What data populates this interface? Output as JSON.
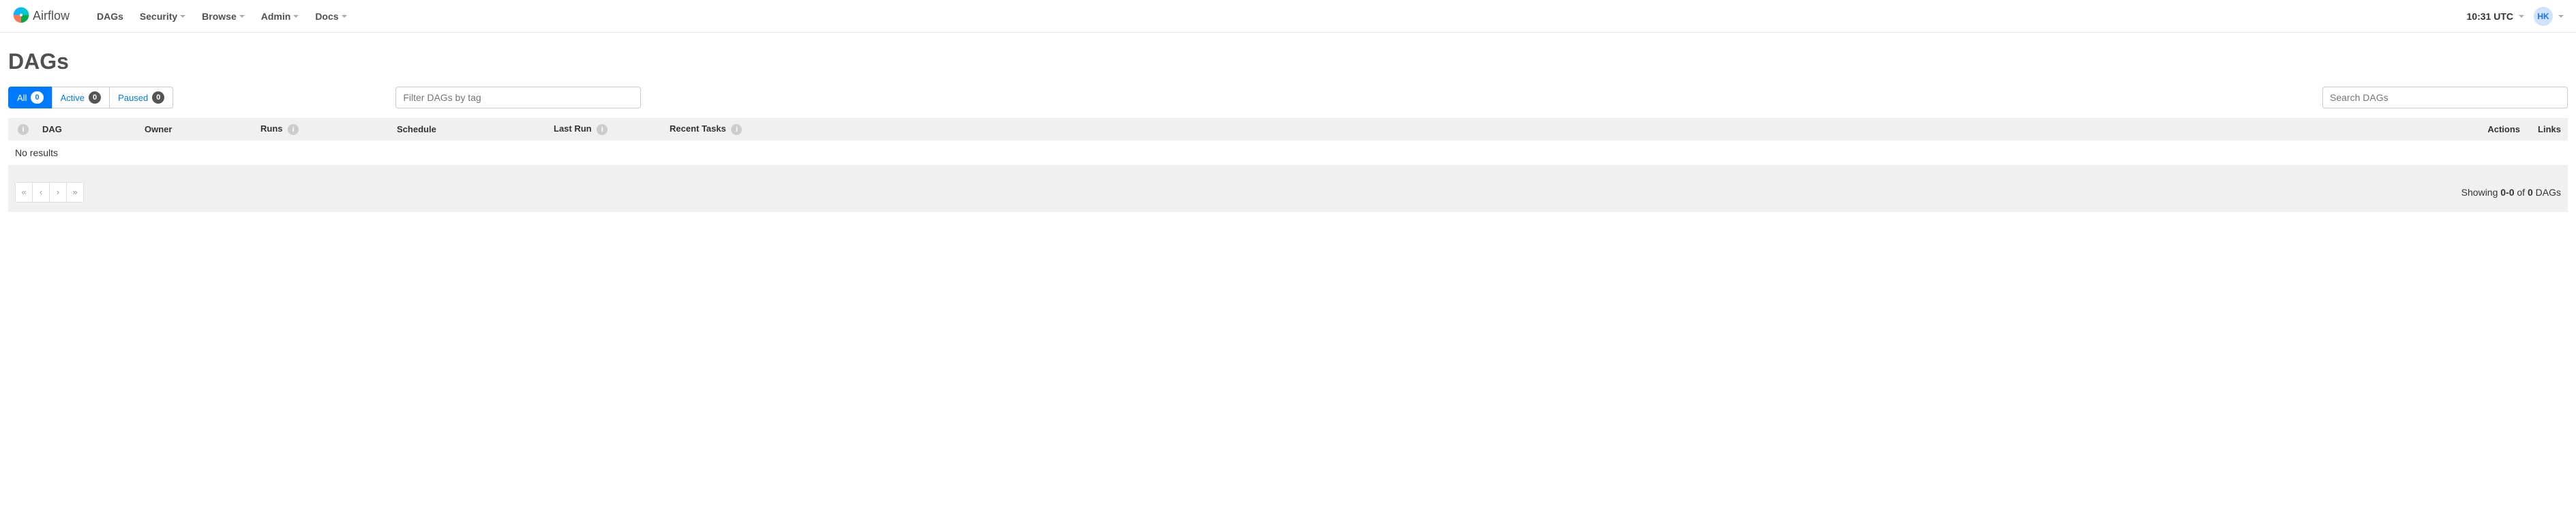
{
  "brand": {
    "name": "Airflow"
  },
  "nav": {
    "items": [
      {
        "label": "DAGs",
        "dropdown": false
      },
      {
        "label": "Security",
        "dropdown": true
      },
      {
        "label": "Browse",
        "dropdown": true
      },
      {
        "label": "Admin",
        "dropdown": true
      },
      {
        "label": "Docs",
        "dropdown": true
      }
    ],
    "clock": "10:31 UTC",
    "user_initials": "HK"
  },
  "page": {
    "title": "DAGs"
  },
  "filters": {
    "all": {
      "label": "All",
      "count": "0"
    },
    "active": {
      "label": "Active",
      "count": "0"
    },
    "paused": {
      "label": "Paused",
      "count": "0"
    }
  },
  "inputs": {
    "tag_filter_placeholder": "Filter DAGs by tag",
    "search_placeholder": "Search DAGs"
  },
  "table": {
    "headers": {
      "dag": "DAG",
      "owner": "Owner",
      "runs": "Runs",
      "schedule": "Schedule",
      "last_run": "Last Run",
      "recent_tasks": "Recent Tasks",
      "actions": "Actions",
      "links": "Links"
    },
    "empty_message": "No results"
  },
  "footer": {
    "showing_prefix": "Showing ",
    "range": "0-0",
    "of": " of ",
    "total": "0",
    "suffix": " DAGs"
  }
}
